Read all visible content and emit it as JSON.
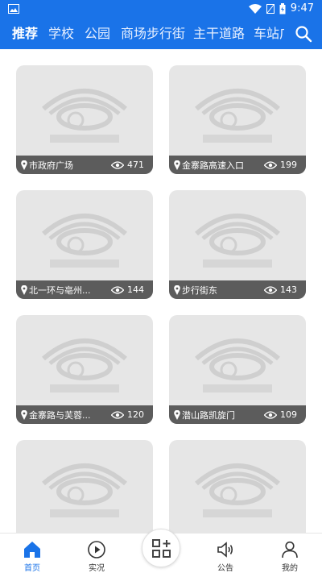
{
  "status_bar": {
    "time": "9:47"
  },
  "tabs": [
    {
      "label": "推荐",
      "active": true
    },
    {
      "label": "学校"
    },
    {
      "label": "公园"
    },
    {
      "label": "商场步行街"
    },
    {
      "label": "主干道路"
    },
    {
      "label": "车站广"
    }
  ],
  "cards": [
    {
      "location": "市政府广场",
      "views": "471"
    },
    {
      "location": "金寨路高速入口",
      "views": "199"
    },
    {
      "location": "北一环与亳州...",
      "views": "144"
    },
    {
      "location": "步行街东",
      "views": "143"
    },
    {
      "location": "金寨路与芙蓉...",
      "views": "120"
    },
    {
      "location": "潜山路凯旋门",
      "views": "109"
    },
    {
      "location": "",
      "views": ""
    },
    {
      "location": "",
      "views": ""
    }
  ],
  "bottom_nav": {
    "home": "首页",
    "live": "实况",
    "notice": "公告",
    "mine": "我的"
  },
  "colors": {
    "brand": "#1a73e8",
    "card_bg": "#e6e6e6",
    "footer_bg": "#5c5c5c"
  }
}
